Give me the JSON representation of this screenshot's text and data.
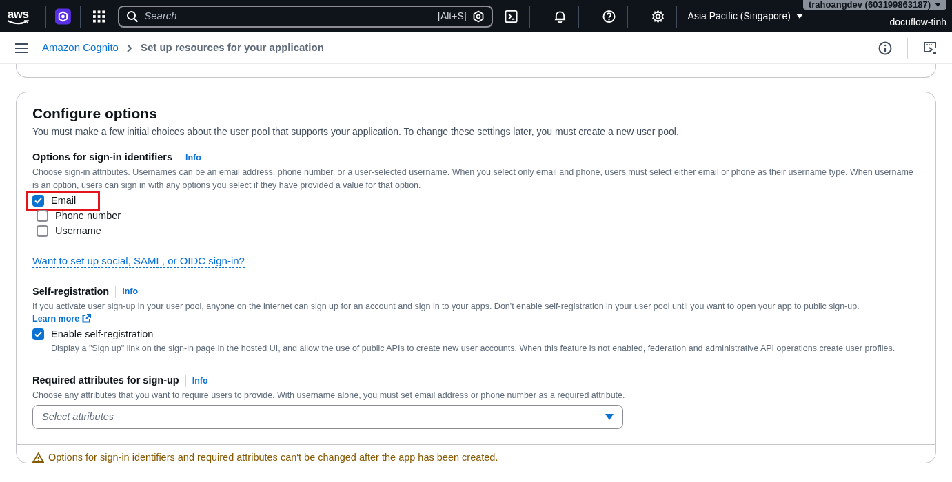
{
  "top_nav": {
    "logo_text": "aws",
    "search": {
      "placeholder": "Search",
      "shortcut": "[Alt+S]"
    },
    "region": "Asia Pacific (Singapore)",
    "account": "trahoangdev (603199863187)",
    "project": "docuflow-tinh"
  },
  "breadcrumb": {
    "items": [
      {
        "label": "Amazon Cognito",
        "kind": "link"
      },
      {
        "label": "Set up resources for your application",
        "kind": "current"
      }
    ]
  },
  "card": {
    "title": "Configure options",
    "description": "You must make a few initial choices about the user pool that supports your application. To change these settings later, you must create a new user pool.",
    "sign_in": {
      "label": "Options for sign-in identifiers",
      "info": "Info",
      "description": "Choose sign-in attributes. Usernames can be an email address, phone number, or a user-selected username. When you select only email and phone, users must select either email or phone as their username type. When username is an option, users can sign in with any options you select if they have provided a value for that option.",
      "options": [
        {
          "label": "Email",
          "checked": true,
          "highlighted": true
        },
        {
          "label": "Phone number",
          "checked": false,
          "highlighted": false
        },
        {
          "label": "Username",
          "checked": false,
          "highlighted": false
        }
      ],
      "link": "Want to set up social, SAML, or OIDC sign-in?"
    },
    "self_registration": {
      "label": "Self-registration",
      "info": "Info",
      "description": "If you activate user sign-up in your user pool, anyone on the internet can sign up for an account and sign in to your apps. Don't enable self-registration in your user pool until you want to open your app to public sign-up.",
      "learn_more": "Learn more",
      "option": {
        "label": "Enable self-registration",
        "checked": true,
        "description": "Display a \"Sign up\" link on the sign-in page in the hosted UI, and allow the use of public APIs to create new user accounts. When this feature is not enabled, federation and administrative API operations create user profiles."
      }
    },
    "required_attributes": {
      "label": "Required attributes for sign-up",
      "info": "Info",
      "description": "Choose any attributes that you want to require users to provide. With username alone, you must set email address or phone number as a required attribute.",
      "select": {
        "placeholder": "Select attributes"
      }
    },
    "warning": "Options for sign-in identifiers and required attributes can't be changed after the app has been created."
  }
}
